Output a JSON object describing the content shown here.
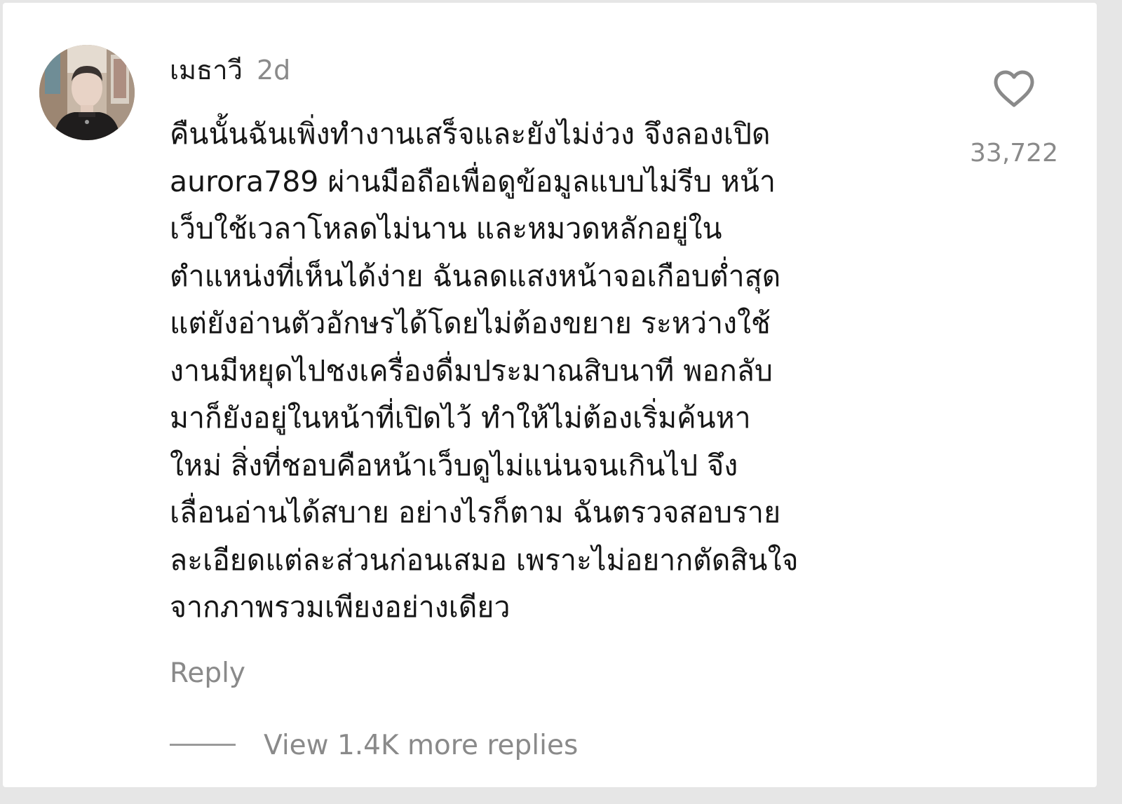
{
  "comment": {
    "username": "เมธาวี",
    "timestamp": "2d",
    "avatar_alt": "avatar",
    "text": "คืนนั้นฉันเพิ่งทำงานเสร็จและยังไม่ง่วง จึงลองเปิด\naurora789 ผ่านมือถือเพื่อดูข้อมูลแบบไม่รีบ หน้า\nเว็บใช้เวลาโหลดไม่นาน และหมวดหลักอยู่ใน\nตำแหน่งที่เห็นได้ง่าย ฉันลดแสงหน้าจอเกือบต่ำสุด\nแต่ยังอ่านตัวอักษรได้โดยไม่ต้องขยาย ระหว่างใช้\nงานมีหยุดไปชงเครื่องดื่มประมาณสิบนาที พอกลับ\nมาก็ยังอยู่ในหน้าที่เปิดไว้ ทำให้ไม่ต้องเริ่มค้นหา\nใหม่ สิ่งที่ชอบคือหน้าเว็บดูไม่แน่นจนเกินไป จึง\nเลื่อนอ่านได้สบาย อย่างไรก็ตาม ฉันตรวจสอบราย\nละเอียดแต่ละส่วนก่อนเสมอ เพราะไม่อยากตัดสินใจ\nจากภาพรวมเพียงอย่างเดียว",
    "like_icon": "heart-outline-icon",
    "like_count": "33,722",
    "reply_label": "Reply",
    "view_replies_label": "View 1.4K more replies"
  },
  "colors": {
    "background": "#ffffff",
    "text_primary": "#161616",
    "text_secondary": "#8a8a8a"
  }
}
